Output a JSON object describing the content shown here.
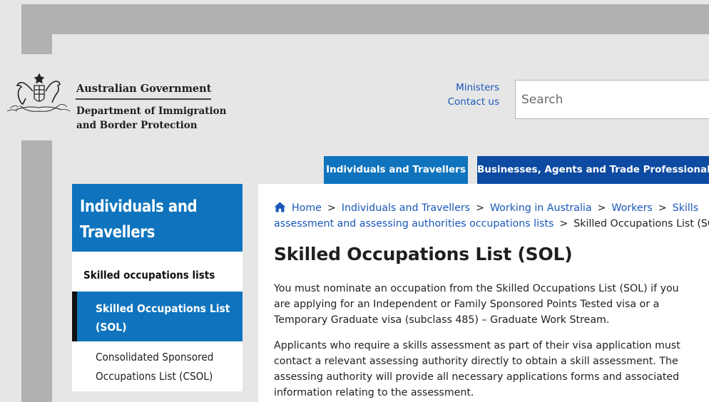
{
  "header": {
    "org_name_line1": "Australian Government",
    "org_name_line2": "Department of Immigration",
    "org_name_line3": "and Border Protection",
    "util_links": [
      "Ministers",
      "Contact us"
    ],
    "search_placeholder": "Search"
  },
  "nav": {
    "tabs": [
      {
        "label": "Individuals and Travellers",
        "color": "#0f74bd",
        "active": true
      },
      {
        "label": "Businesses, Agents and Trade Professionals",
        "color": "#0d4aa1",
        "active": false
      }
    ]
  },
  "sidebar": {
    "heading": "Individuals and Travellers",
    "section": "Skilled occupations lists",
    "items": [
      {
        "label": "Skilled Occupations List (SOL)",
        "active": true
      },
      {
        "label": "Consolidated Sponsored Occupations List (CSOL)",
        "active": false
      }
    ]
  },
  "breadcrumb": {
    "items": [
      "Home",
      "Individuals and Travellers",
      "Working in Australia",
      "Workers",
      "Skills assessment and assessing authorities",
      "occupations lists"
    ],
    "current": "Skilled Occupations List (SOL)",
    "separator": ">"
  },
  "main": {
    "title": "Skilled Occupations List (SOL)",
    "paragraphs": [
      "You must nominate an occupation from the Skilled Occupations List (SOL) if you are applying for an Independent or Family Sponsored Points Tested visa or a Temporary Graduate visa (subclass 485) – Graduate Work Stream.",
      "Applicants who require a skills assessment as part of their visa application must contact a relevant assessing authority directly to obtain a skill assessment. The assessing authority will provide all necessary applications forms and associated information relating to the assessment."
    ]
  },
  "colors": {
    "brand_blue": "#0f74bd",
    "dark_blue": "#0d4aa1",
    "link": "#1a57b8"
  },
  "icons": [
    "coat-of-arms-icon",
    "home-icon"
  ]
}
